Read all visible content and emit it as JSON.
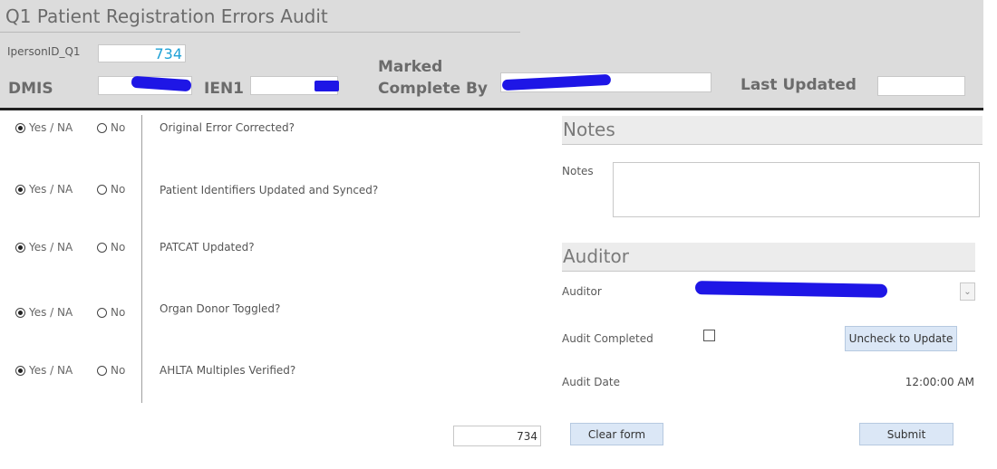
{
  "header": {
    "title": "Q1 Patient Registration Errors Audit",
    "ipersonid_label": "IpersonID_Q1",
    "ipersonid_value": "734",
    "dmis_label": "DMIS",
    "ien1_label": "IEN1",
    "marked_label_line1": "Marked",
    "marked_label_line2": "Complete By",
    "last_updated_label": "Last Updated",
    "last_updated_value": ""
  },
  "questions": {
    "yes_label": "Yes / NA",
    "no_label": "No",
    "items": [
      {
        "label": "Original Error Corrected?",
        "selected": "yes"
      },
      {
        "label": "Patient Identifiers Updated and Synced?",
        "selected": "yes"
      },
      {
        "label": "PATCAT Updated?",
        "selected": "yes"
      },
      {
        "label": "Organ Donor Toggled?",
        "selected": "yes"
      },
      {
        "label": "AHLTA Multiples Verified?",
        "selected": "yes"
      }
    ]
  },
  "footer": {
    "record_value": "734",
    "clear_label": "Clear form",
    "submit_label": "Submit"
  },
  "notes": {
    "heading": "Notes",
    "field_label": "Notes",
    "value": ""
  },
  "auditor": {
    "heading": "Auditor",
    "auditor_label": "Auditor",
    "audit_completed_label": "Audit Completed",
    "audit_completed_checked": false,
    "uncheck_button_label": "Uncheck to Update",
    "audit_date_label": "Audit Date",
    "audit_date_value": "12:00:00 AM"
  },
  "icons": {
    "dropdown": "chevron-down-icon"
  },
  "colors": {
    "header_bg": "#dcdcdc",
    "redaction": "#1e16e6",
    "id_value": "#1ea1d6",
    "button_bg": "#dbe7f6"
  }
}
